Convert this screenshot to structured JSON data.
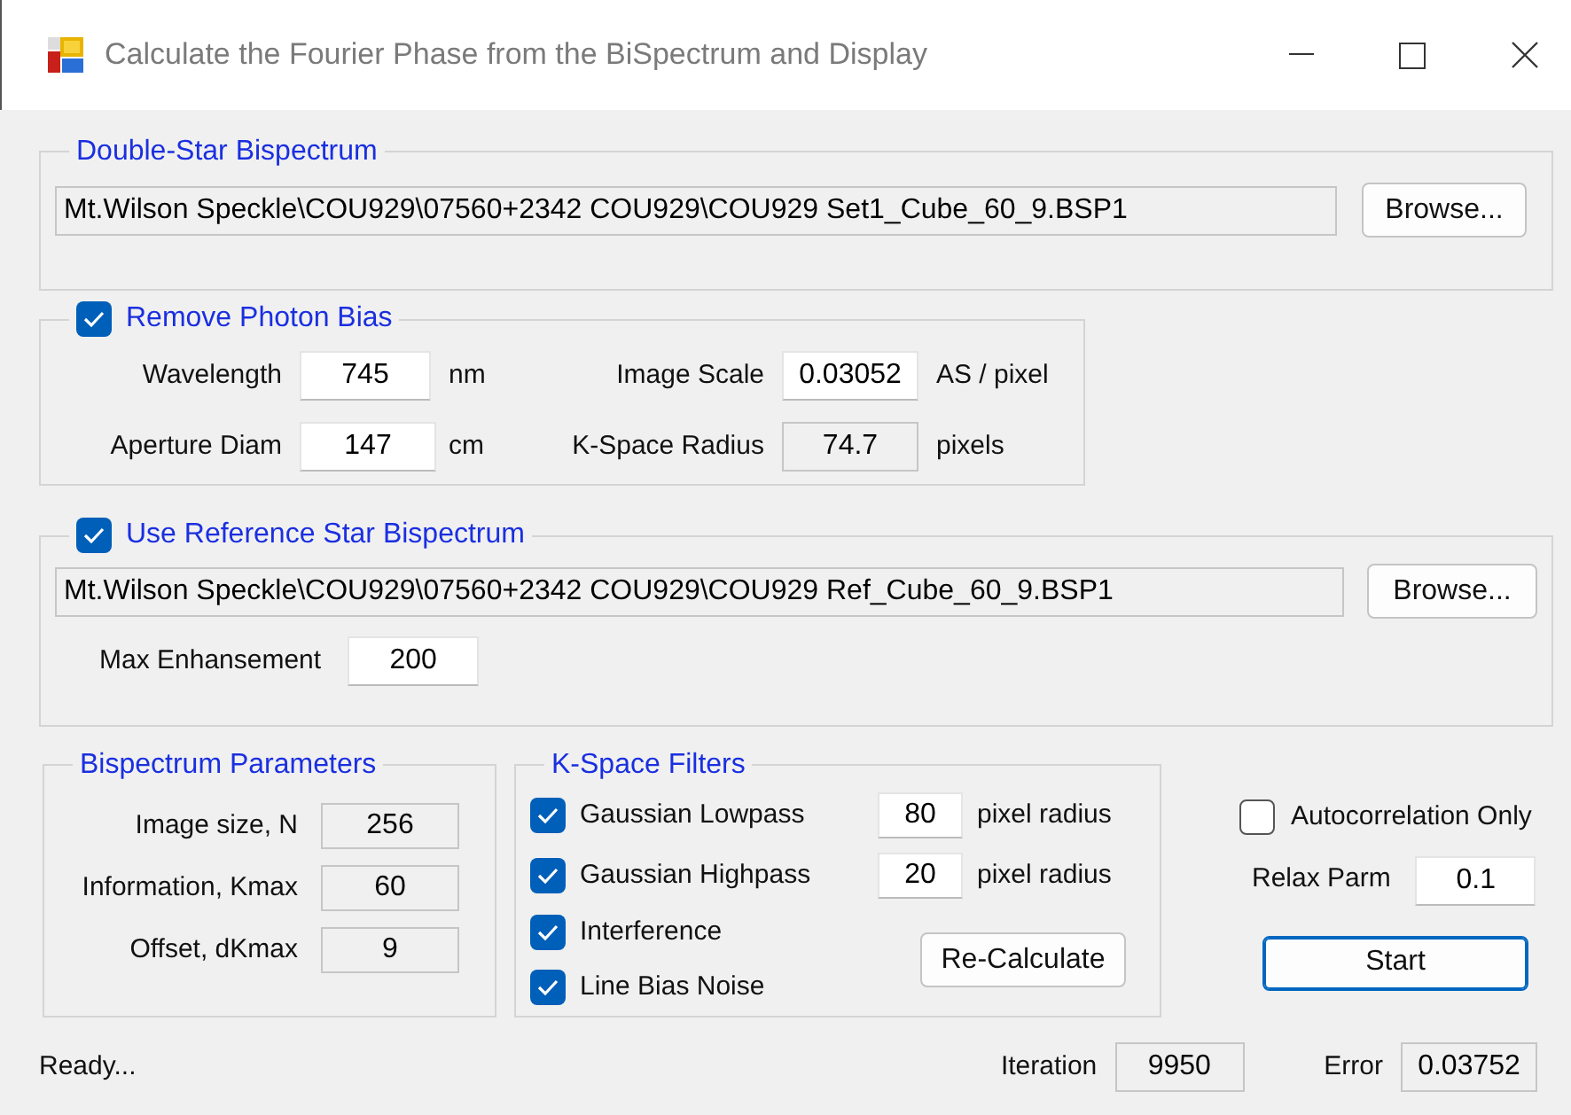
{
  "window": {
    "title": "Calculate the Fourier Phase from the BiSpectrum and Display"
  },
  "double_star": {
    "title": "Double-Star Bispectrum",
    "path": "Mt.Wilson Speckle\\COU929\\07560+2342 COU929\\COU929 Set1_Cube_60_9.BSP1",
    "button": "Browse..."
  },
  "photon_bias": {
    "label": "Remove Photon Bias",
    "checked": true,
    "fields": [
      {
        "label": "Wavelength",
        "value": "745",
        "unit": "nm",
        "readonly": false
      },
      {
        "label": "Image Scale",
        "value": "0.03052",
        "unit": "AS / pixel",
        "readonly": false
      },
      {
        "label": "Aperture Diam",
        "value": "147",
        "unit": "cm",
        "readonly": false
      },
      {
        "label": "K-Space Radius",
        "value": "74.7",
        "unit": "pixels",
        "readonly": true
      }
    ]
  },
  "reference": {
    "label": "Use Reference Star Bispectrum",
    "checked": true,
    "path": "Mt.Wilson Speckle\\COU929\\07560+2342 COU929\\COU929 Ref_Cube_60_9.BSP1",
    "button": "Browse...",
    "max_label": "Max Enhansement",
    "max_value": "200"
  },
  "bispectrum_parameters": {
    "title": "Bispectrum Parameters",
    "rows": [
      {
        "label": "Image size, N",
        "value": "256"
      },
      {
        "label": "Information, Kmax",
        "value": "60"
      },
      {
        "label": "Offset, dKmax",
        "value": "9"
      }
    ]
  },
  "filters": {
    "title": "K-Space Filters",
    "items": [
      {
        "label": "Gaussian Lowpass",
        "checked": true,
        "value": "80",
        "unit": "pixel radius"
      },
      {
        "label": "Gaussian Highpass",
        "checked": true,
        "value": "20",
        "unit": "pixel radius"
      },
      {
        "label": "Interference",
        "checked": true
      },
      {
        "label": "Line Bias Noise",
        "checked": true
      }
    ],
    "button": "Re-Calculate"
  },
  "autocorrelation": {
    "label": "Autocorrelation Only",
    "checked": false
  },
  "relax": {
    "label": "Relax Parm",
    "value": "0.1"
  },
  "start_button": "Start",
  "status_bar": {
    "message": "Ready...",
    "iteration_label": "Iteration",
    "iteration": "9950",
    "error_label": "Error",
    "error": "0.03752"
  }
}
